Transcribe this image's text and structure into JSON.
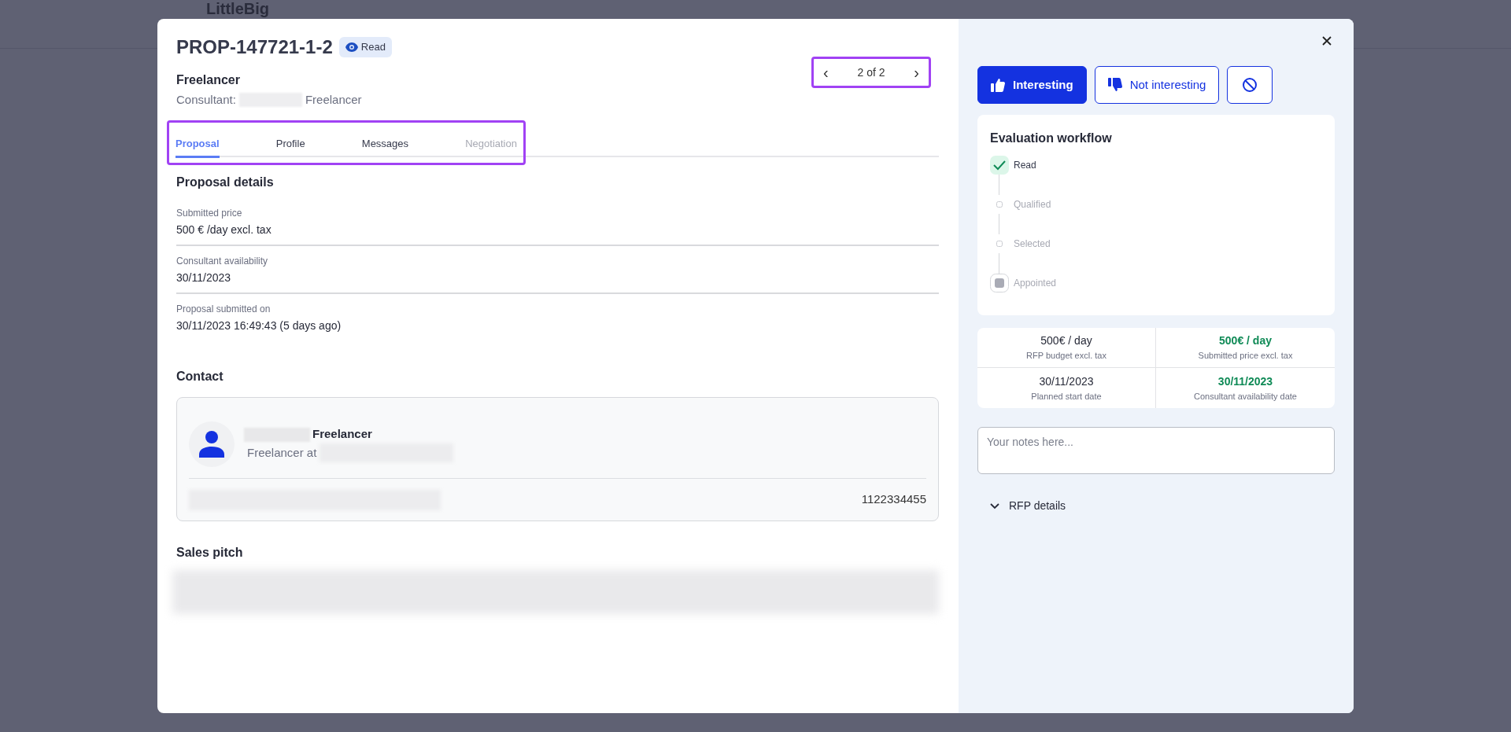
{
  "background": {
    "app_name": "LittleBig"
  },
  "header": {
    "reference": "PROP-147721-1-2",
    "badge": "Read",
    "role": "Freelancer",
    "consultant_label": "Consultant:",
    "consultant_name": "Freelancer"
  },
  "pager": {
    "prev": "‹",
    "text": "2 of 2",
    "next": "›"
  },
  "tabs": [
    {
      "label": "Proposal",
      "selected": true,
      "disabled": false
    },
    {
      "label": "Profile",
      "selected": false,
      "disabled": false
    },
    {
      "label": "Messages",
      "selected": false,
      "disabled": false
    },
    {
      "label": "Negotiation",
      "selected": false,
      "disabled": true
    }
  ],
  "proposal_details": {
    "title": "Proposal details",
    "fields": [
      {
        "label": "Submitted price",
        "value": "500 € /day excl. tax"
      },
      {
        "label": "Consultant availability",
        "value": "30/11/2023"
      },
      {
        "label": "Proposal submitted on",
        "value": "30/11/2023 16:49:43 (5 days ago)"
      }
    ]
  },
  "contact": {
    "title": "Contact",
    "name": "Freelancer",
    "position": "Freelancer at",
    "phone": "1122334455"
  },
  "sales_pitch": {
    "title": "Sales pitch"
  },
  "actions": [
    {
      "kind": "like",
      "label": "Interesting",
      "selected": true
    },
    {
      "kind": "dislike",
      "label": "Not interesting",
      "selected": false
    },
    {
      "kind": "ban",
      "selected": false
    }
  ],
  "workflow": {
    "title": "Evaluation workflow",
    "steps": [
      {
        "label": "Read",
        "kind": "done"
      },
      {
        "label": "Qualified",
        "kind": "pending"
      },
      {
        "label": "Selected",
        "kind": "pending"
      },
      {
        "label": "Appointed",
        "kind": "final"
      }
    ]
  },
  "stats": [
    {
      "value": "500€ / day",
      "label": "RFP budget excl. tax",
      "highlight": false
    },
    {
      "value": "500€ / day",
      "label": "Submitted price excl. tax",
      "highlight": true
    },
    {
      "value": "30/11/2023",
      "label": "Planned start date",
      "highlight": false
    },
    {
      "value": "30/11/2023",
      "label": "Consultant availability date",
      "highlight": true
    }
  ],
  "notes": {
    "placeholder": "Your notes here..."
  },
  "rfp_details": {
    "label": "RFP details",
    "expanded": false
  }
}
